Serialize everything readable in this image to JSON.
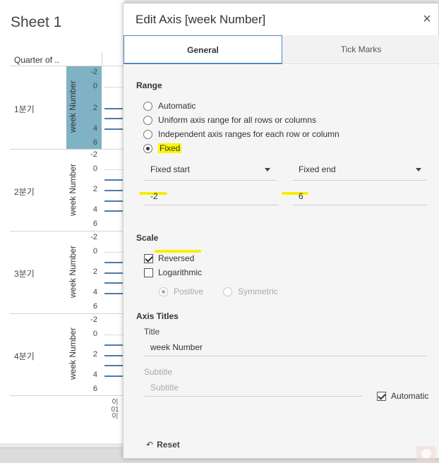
{
  "sheet": {
    "title": "Sheet 1",
    "column_header": "Quarter of ..",
    "axis_title": "week Number",
    "tick_labels": [
      "-2",
      "0",
      "2",
      "4",
      "6"
    ],
    "quarters": [
      "1분기",
      "2분기",
      "3분기",
      "4분기"
    ],
    "bottom_label": "이\n01\n이"
  },
  "dialog": {
    "title": "Edit Axis [week Number]",
    "close_label": "×",
    "tabs": [
      {
        "label": "General",
        "active": true
      },
      {
        "label": "Tick Marks",
        "active": false
      }
    ],
    "range": {
      "heading": "Range",
      "options": [
        {
          "label": "Automatic",
          "checked": false
        },
        {
          "label": "Uniform axis range for all rows or columns",
          "checked": false
        },
        {
          "label": "Independent axis ranges for each row or column",
          "checked": false
        },
        {
          "label": "Fixed",
          "checked": true
        }
      ],
      "start_mode": "Fixed start",
      "end_mode": "Fixed end",
      "start_value": "-2",
      "end_value": "6"
    },
    "scale": {
      "heading": "Scale",
      "reversed_label": "Reversed",
      "reversed_checked": true,
      "logarithmic_label": "Logarithmic",
      "logarithmic_checked": false,
      "positive_label": "Positive",
      "symmetric_label": "Symmetric"
    },
    "axis_titles": {
      "heading": "Axis Titles",
      "title_label": "Title",
      "title_value": "week Number",
      "subtitle_label": "Subtitle",
      "subtitle_placeholder": "Subtitle",
      "automatic_label": "Automatic",
      "automatic_checked": true
    },
    "reset_label": "Reset"
  },
  "colors": {
    "accent": "#4e88c7",
    "highlight": "#fbf800",
    "axis_band": "#7fb2c4",
    "bar": "#4e79a7"
  }
}
